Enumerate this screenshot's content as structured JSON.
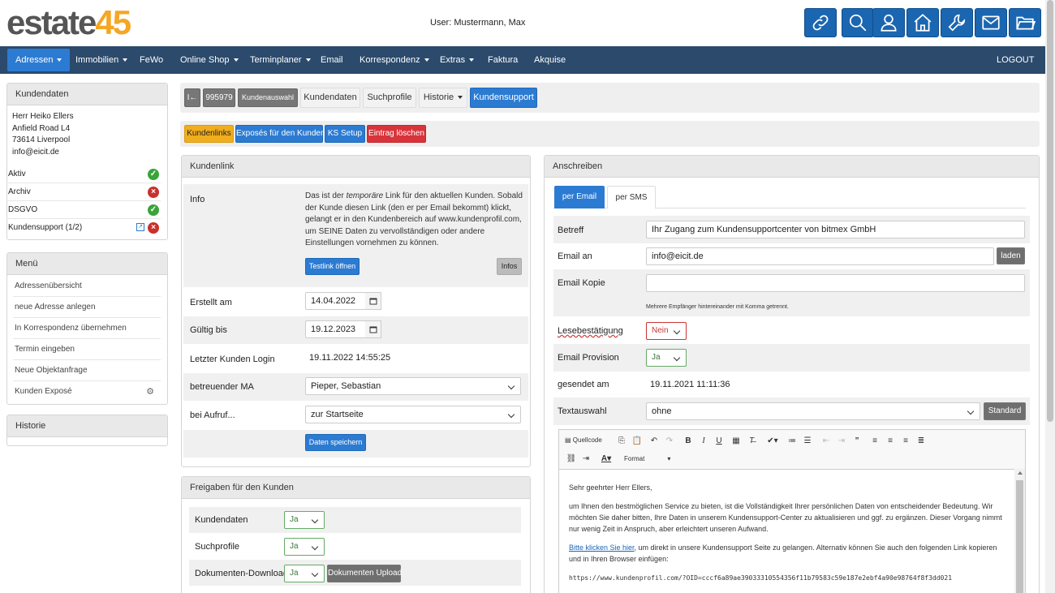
{
  "header": {
    "logo_part1": "estate",
    "logo_part2": "45",
    "user_label": "User: Mustermann, Max",
    "icons": [
      "link-icon",
      "search-icon",
      "user-icon",
      "home-icon",
      "wrench-icon",
      "mail-icon",
      "folder-icon"
    ]
  },
  "nav": {
    "items": [
      "Adressen",
      "Immobilien",
      "FeWo",
      "Online Shop",
      "Terminplaner",
      "Email",
      "Korrespondenz",
      "Extras",
      "Faktura",
      "Akquise"
    ],
    "logout": "LOGOUT"
  },
  "sidebar": {
    "customer_title": "Kundendaten",
    "address": [
      "Herr Heiko Ellers",
      "Anfield Road L4",
      "73614 Liverpool",
      "info@eicit.de"
    ],
    "status": [
      {
        "label": "Aktiv",
        "state": "ok"
      },
      {
        "label": "Archiv",
        "state": "no"
      },
      {
        "label": "DSGVO",
        "state": "ok"
      },
      {
        "label": "Kundensupport (1/2)",
        "state": "no"
      }
    ],
    "menu_title": "Menü",
    "menu_items": [
      "Adressenübersicht",
      "neue Adresse anlegen",
      "In Korrespondenz übernehmen",
      "Termin eingeben",
      "Neue Objektanfrage",
      "Kunden Exposé"
    ],
    "history_title": "Historie"
  },
  "toolbar": {
    "back_glyph": "I←",
    "id": "995979",
    "kundenauswahl": "Kundenauswahl",
    "kundendaten": "Kundendaten",
    "suchprofile": "Suchprofile",
    "historie": "Historie",
    "kundensupport": "Kundensupport"
  },
  "actions": {
    "kundenlinks": "Kundenlinks",
    "exposes": "Exposés für den Kunden",
    "ks_setup": "KS Setup",
    "delete": "Eintrag löschen"
  },
  "kundenlink": {
    "title": "Kundenlink",
    "info_label": "Info",
    "info_text_1": "Das ist der ",
    "info_text_em": "temporäre",
    "info_text_2": " Link für den aktuellen Kunden. Sobald der Kunde diesen Link (den er per Email bekommt) klickt, gelangt er in den Kundenbereich auf www.kundenprofil.com, um SEINE Daten zu vervollständigen oder andere Einstellungen vornehmen zu können.",
    "testlink_button": "Testlink öffnen",
    "infos_button": "Infos",
    "erstellt_label": "Erstellt am",
    "erstellt_value": "14.04.2022",
    "gueltig_label": "Gültig bis",
    "gueltig_value": "19.12.2023",
    "login_label": "Letzter Kunden Login",
    "login_value": "19.11.2022 14:55:25",
    "ma_label": "betreuender MA",
    "ma_value": "Pieper, Sebastian",
    "aufruf_label": "bei Aufruf...",
    "aufruf_value": "zur Startseite",
    "save_button": "Daten speichern"
  },
  "freigaben": {
    "title": "Freigaben für den Kunden",
    "rows": [
      {
        "label": "Kundendaten",
        "value": "Ja"
      },
      {
        "label": "Suchprofile",
        "value": "Ja"
      },
      {
        "label": "Dokumenten-Download",
        "value": "Ja"
      }
    ],
    "upload_button": "Dokumenten Upload"
  },
  "anschreiben": {
    "title": "Anschreiben",
    "tab_email": "per Email",
    "tab_sms": "per SMS",
    "betreff_label": "Betreff",
    "betreff_value": "Ihr Zugang zum Kundensupportcenter von bitmex GmbH",
    "email_an_label": "Email an",
    "email_an_value": "info@eicit.de",
    "laden_button": "laden",
    "email_kopie_label": "Email Kopie",
    "email_kopie_value": "",
    "hint": "Mehrere Empfänger hintereinander mit Komma getrennt.",
    "lese_label": "Lesebestätigung",
    "lese_value": "Nein",
    "provision_label": "Email Provision",
    "provision_value": "Ja",
    "gesendet_label": "gesendet am",
    "gesendet_value": "19.11.2021 11:11:36",
    "textauswahl_label": "Textauswahl",
    "textauswahl_value": "ohne",
    "standard_button": "Standard"
  },
  "editor": {
    "source_label": "Quellcode",
    "format_label": "Format",
    "greeting": "Sehr geehrter Herr Ellers,",
    "para1": "um Ihnen den bestmöglichen Service zu bieten, ist die Vollständigkeit Ihrer persönlichen Daten von entscheidender Bedeutung. Wir möchten Sie daher bitten, Ihre Daten in unserem Kundensupport-Center zu aktualisieren und ggf. zu ergänzen. Dieser Vorgang nimmt nur wenig Zeit in Anspruch, aber erleichtert unseren Aufwand.",
    "link_text": "Bitte klicken Sie hier",
    "para2_rest": ", um direkt in unsere Kundensupport Seite zu gelangen. Alternativ können Sie auch den folgenden Link kopieren und in Ihren Browser einfügen:",
    "url": "https://www.kundenprofil.com/?OID=cccf6a89ae39033310554356f11b79583c59e187e2ebf4a90e98764f8f3dd021"
  }
}
